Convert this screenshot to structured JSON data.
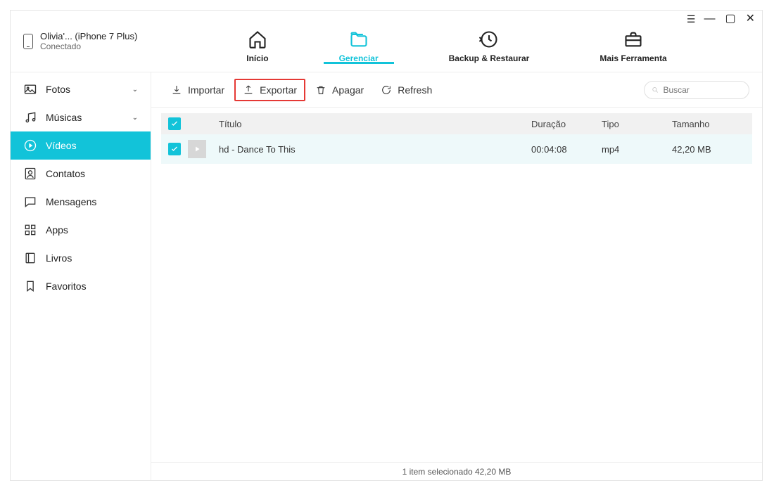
{
  "device": {
    "name": "Olivia'... (iPhone 7 Plus)",
    "status": "Conectado"
  },
  "nav": {
    "home": {
      "label": "Início"
    },
    "manage": {
      "label": "Gerenciar"
    },
    "backup": {
      "label": "Backup & Restaurar"
    },
    "tools": {
      "label": "Mais Ferramenta"
    }
  },
  "sidebar": {
    "photos": {
      "label": "Fotos"
    },
    "music": {
      "label": "Músicas"
    },
    "videos": {
      "label": "Vídeos"
    },
    "contacts": {
      "label": "Contatos"
    },
    "messages": {
      "label": "Mensagens"
    },
    "apps": {
      "label": "Apps"
    },
    "books": {
      "label": "Livros"
    },
    "favs": {
      "label": "Favoritos"
    }
  },
  "toolbar": {
    "import": "Importar",
    "export": "Exportar",
    "delete": "Apagar",
    "refresh": "Refresh"
  },
  "search": {
    "placeholder": "Buscar"
  },
  "columns": {
    "title": "Título",
    "duration": "Duração",
    "type": "Tipo",
    "size": "Tamanho"
  },
  "rows": [
    {
      "title": "hd - Dance To This",
      "duration": "00:04:08",
      "type": "mp4",
      "size": "42,20 MB"
    }
  ],
  "footer": "1 item selecionado 42,20 MB"
}
